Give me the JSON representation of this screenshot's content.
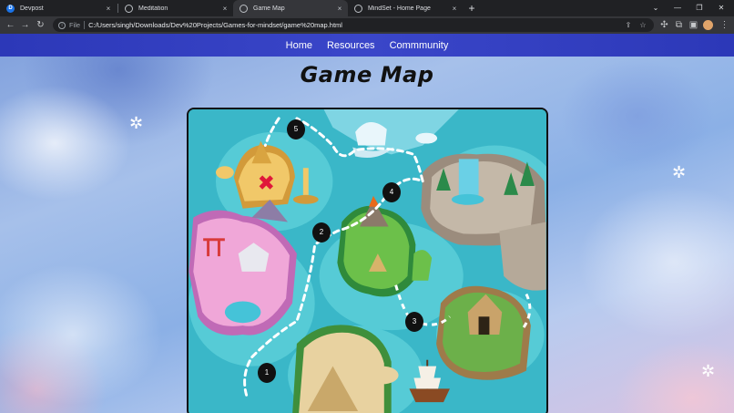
{
  "browser": {
    "tabs": [
      {
        "title": "Devpost",
        "favicon": "devpost-icon",
        "favicon_letter": "D",
        "active": false
      },
      {
        "title": "Meditation",
        "favicon": "globe-icon",
        "active": false
      },
      {
        "title": "Game Map",
        "favicon": "globe-icon",
        "active": true
      },
      {
        "title": "MindSet - Home Page",
        "favicon": "globe-icon",
        "active": false
      }
    ],
    "close_glyph": "×",
    "new_tab_glyph": "+",
    "window_controls": {
      "menu": "⌄",
      "minimize": "—",
      "maximize": "❐",
      "close": "✕"
    },
    "nav": {
      "back": "←",
      "forward": "→",
      "reload": "↻"
    },
    "address": {
      "scheme_label": "File",
      "url": "C:/Users/singh/Downloads/Dev%20Projects/Games-for-mindset/game%20map.html"
    },
    "toolbar_icons": [
      "share-icon",
      "star-icon",
      "extensions-icon",
      "sync-icon",
      "sidepanel-icon",
      "avatar",
      "menu-icon"
    ]
  },
  "page": {
    "nav_links": [
      "Home",
      "Resources",
      "Commmunity"
    ],
    "title": "Game Map",
    "markers": [
      "1",
      "2",
      "3",
      "4",
      "5"
    ]
  },
  "colors": {
    "navbar": "#3a46c9",
    "ocean": "#3ab7c8",
    "marker": "#111111"
  }
}
